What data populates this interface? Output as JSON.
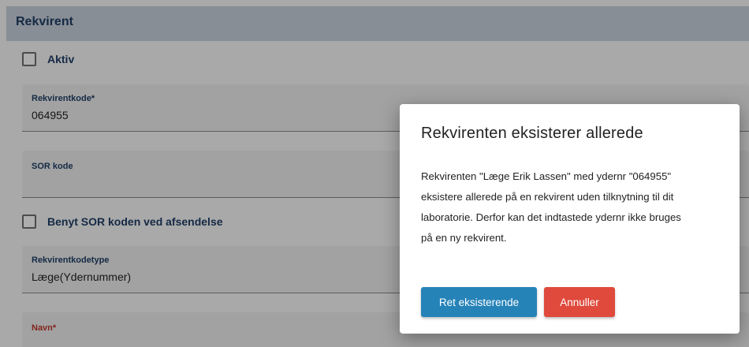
{
  "panel": {
    "title": "Rekvirent"
  },
  "form": {
    "aktiv_label": "Aktiv",
    "rekvirentkode": {
      "label": "Rekvirentkode*",
      "value": "064955"
    },
    "sor_kode": {
      "label": "SOR kode",
      "value": ""
    },
    "benyt_sor_label": "Benyt SOR koden ved afsendelse",
    "rekvirentkodetype": {
      "label": "Rekvirentkodetype",
      "value": "Læge(Ydernummer)"
    },
    "navn": {
      "label": "Navn*",
      "value": ""
    }
  },
  "modal": {
    "title": "Rekvirenten eksisterer allerede",
    "body_lines": [
      "Rekvirenten \"Læge Erik Lassen\" med ydernr \"064955\"",
      "eksistere allerede på en rekvirent uden tilknytning til dit",
      "laboratorie. Derfor kan det indtastede ydernr ikke bruges",
      "på en ny rekvirent."
    ],
    "confirm_label": "Ret eksisterende",
    "cancel_label": "Annuller"
  },
  "colors": {
    "header_bg": "#c9d2dc",
    "title_text": "#1f3f66",
    "primary_button": "#2683b8",
    "danger_button": "#df4a3c",
    "required_error_label": "#c0392b"
  }
}
